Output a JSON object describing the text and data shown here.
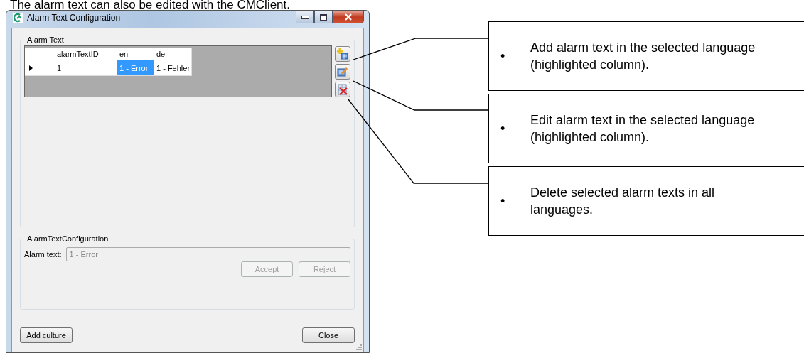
{
  "heading": "The alarm text can also be edited with the CMClient.",
  "window": {
    "title": "Alarm Text Configuration"
  },
  "alarm_text_group": {
    "title": "Alarm Text",
    "table": {
      "columns": [
        "alarmTextID",
        "en",
        "de"
      ],
      "rows": [
        {
          "current": true,
          "cells": [
            {
              "text": "1",
              "selected": false
            },
            {
              "text": "1 - Error",
              "selected": true
            },
            {
              "text": "1 - Fehler",
              "selected": false
            }
          ]
        }
      ]
    },
    "side_buttons": [
      {
        "kind": "add"
      },
      {
        "kind": "edit"
      },
      {
        "kind": "delete"
      }
    ]
  },
  "config_group": {
    "title": "AlarmTextConfiguration",
    "label": "Alarm text:",
    "value": "1 - Error",
    "disabled": true,
    "buttons": [
      {
        "label": "Accept",
        "disabled": true
      },
      {
        "label": "Reject",
        "disabled": true
      }
    ]
  },
  "footer_buttons": [
    "Add culture",
    "Close"
  ],
  "callouts": [
    {
      "bullet": "•",
      "text": "Add alarm text in the selected language (highlighted column)."
    },
    {
      "bullet": "•",
      "text": "Edit alarm text in the selected language (highlighted column)."
    },
    {
      "bullet": "•",
      "text": "Delete selected alarm texts in all languages."
    }
  ]
}
